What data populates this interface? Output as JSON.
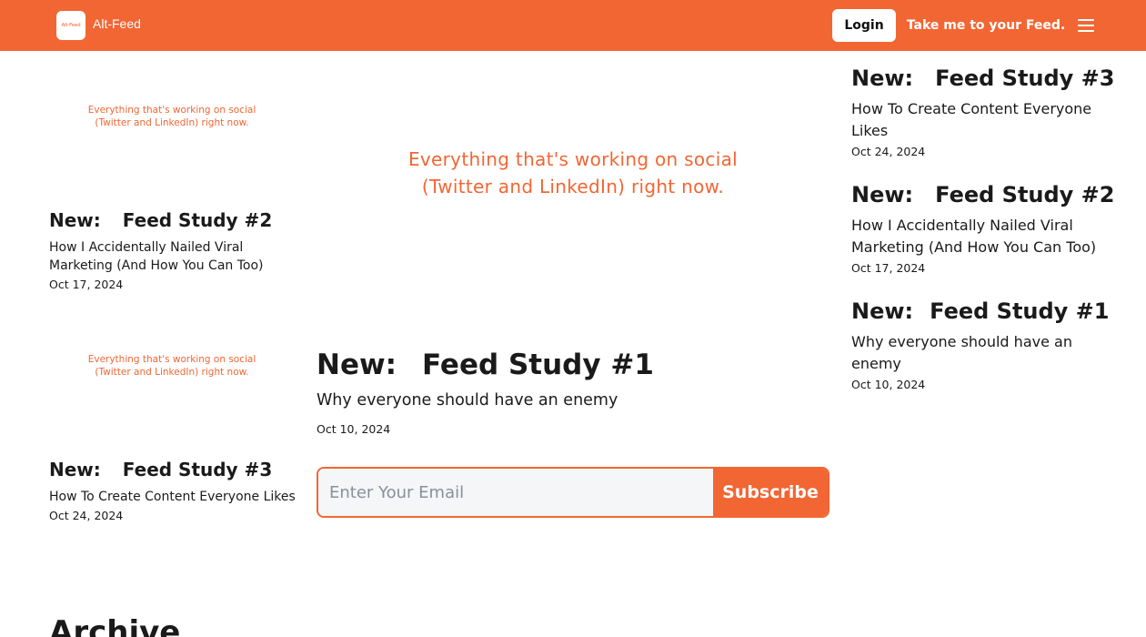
{
  "header": {
    "brand": "Alt-Feed",
    "logo_text": "Alt-Feed",
    "login_label": "Login",
    "feed_label": "Take me to your Feed.",
    "menu_icon": "hamburger-menu-icon"
  },
  "thumbnail": {
    "line1": "Everything that's working on social",
    "line2": "(Twitter and LinkedIn) right now."
  },
  "left_posts": [
    {
      "prefix": "New:",
      "title": "Feed Study #2",
      "desc": "How I Accidentally Nailed Viral Marketing (And How You Can Too)",
      "date": "Oct 17, 2024"
    },
    {
      "prefix": "New:",
      "title": "Feed Study #3",
      "desc": "How To Create Content Everyone Likes",
      "date": "Oct 24, 2024"
    }
  ],
  "featured": {
    "prefix": "New:",
    "title": "Feed Study #1",
    "desc": "Why everyone should have an enemy",
    "date": "Oct 10, 2024"
  },
  "right_posts": [
    {
      "prefix": "New:",
      "title": "Feed Study #3",
      "desc": "How To Create Content Everyone Likes",
      "date": "Oct 24, 2024"
    },
    {
      "prefix": "New:",
      "title": "Feed Study #2",
      "desc": "How I Accidentally Nailed Viral Marketing (And How You Can Too)",
      "date": "Oct 17, 2024"
    },
    {
      "prefix": "New:",
      "title": "Feed Study #1",
      "desc": "Why everyone should have an enemy",
      "date": "Oct 10, 2024"
    }
  ],
  "subscribe": {
    "placeholder": "Enter Your Email",
    "button_label": "Subscribe"
  },
  "archive_heading": "Archive",
  "colors": {
    "accent": "#f26633",
    "text": "#1a1a1a"
  }
}
